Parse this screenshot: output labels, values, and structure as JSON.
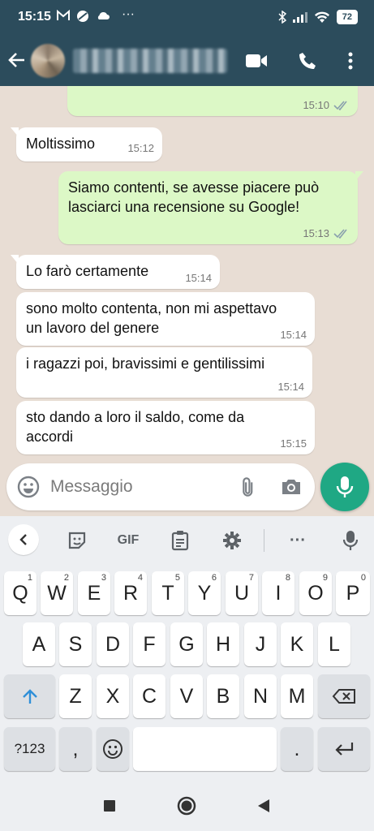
{
  "status_bar": {
    "time": "15:15",
    "notif_icons": [
      "gmail-icon",
      "app-icon",
      "cloud-icon",
      "more-icon"
    ],
    "more": "···",
    "battery": "72"
  },
  "header": {
    "contact_name": "",
    "actions": [
      "video-call-icon",
      "voice-call-icon",
      "menu-icon"
    ]
  },
  "messages": [
    {
      "dir": "out",
      "text": "",
      "time": "15:10",
      "read": true
    },
    {
      "dir": "in",
      "text": "Moltissimo",
      "time": "15:12"
    },
    {
      "dir": "out",
      "text": "Siamo contenti, se avesse piacere può lasciarci una recensione su Google!",
      "time": "15:13",
      "read": true
    },
    {
      "dir": "in",
      "text": "Lo farò certamente",
      "time": "15:14"
    },
    {
      "dir": "in",
      "text": "sono molto contenta, non mi aspettavo un lavoro del genere",
      "time": "15:14"
    },
    {
      "dir": "in",
      "text": "i ragazzi poi, bravissimi e gentilissimi",
      "time": "15:14"
    },
    {
      "dir": "in",
      "text": "sto dando a loro il saldo, come da accordi",
      "time": "15:15"
    }
  ],
  "composer": {
    "placeholder": "Messaggio"
  },
  "keyboard": {
    "toolbar": {
      "gif": "GIF",
      "more": "···"
    },
    "row1": [
      [
        "Q",
        "1"
      ],
      [
        "W",
        "2"
      ],
      [
        "E",
        "3"
      ],
      [
        "R",
        "4"
      ],
      [
        "T",
        "5"
      ],
      [
        "Y",
        "6"
      ],
      [
        "U",
        "7"
      ],
      [
        "I",
        "8"
      ],
      [
        "O",
        "9"
      ],
      [
        "P",
        "0"
      ]
    ],
    "row2": [
      "A",
      "S",
      "D",
      "F",
      "G",
      "H",
      "J",
      "K",
      "L"
    ],
    "row3": [
      "Z",
      "X",
      "C",
      "V",
      "B",
      "N",
      "M"
    ],
    "symbols_key": "?123",
    "comma": ",",
    "period": "."
  },
  "colors": {
    "header": "#2c4c5c",
    "outgoing": "#dcf8c6",
    "incoming": "#ffffff",
    "accent": "#1fa884",
    "read_ticks": "#8aa0ad"
  }
}
